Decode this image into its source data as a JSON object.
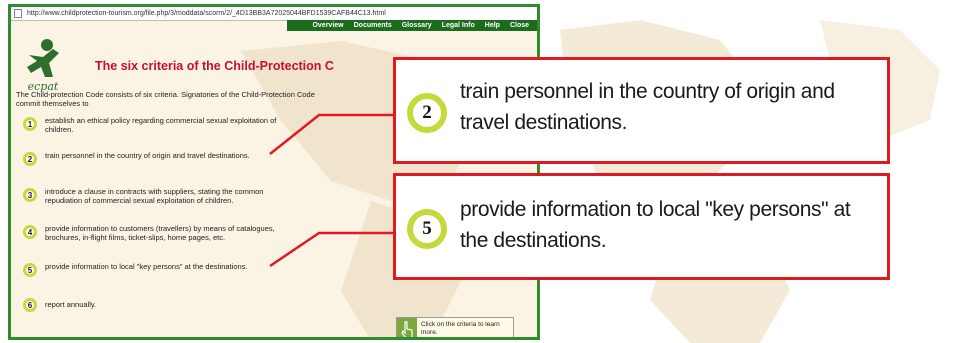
{
  "browser": {
    "url": "http://www.childprotection-tourism.org/file.php/3/moddata/scorm/2/_4D13BB3A72025044BFD1539CAFB44C13.html"
  },
  "nav": [
    "Overview",
    "Documents",
    "Glossary",
    "Legal Info",
    "Help",
    "Close"
  ],
  "logo": {
    "text": "ecpat"
  },
  "title": "The six criteria of the Child-Protection C",
  "intro": "The Child-protection Code consists of six criteria. Signatories of the Child-Protection Code commit themselves to",
  "criteria": [
    {
      "num": "1",
      "text": "establish an ethical policy regarding commercial sexual exploitation of children."
    },
    {
      "num": "2",
      "text": "train personnel in the country of origin and travel destinations."
    },
    {
      "num": "3",
      "text": "introduce a clause in contracts with suppliers, stating the common repudiation of commercial sexual exploitation of children."
    },
    {
      "num": "4",
      "text": "provide information to customers (travellers) by means of catalogues, brochures, in-flight films, ticket-slips, home pages, etc."
    },
    {
      "num": "5",
      "text": "provide information to local \"key persons\" at the destinations."
    },
    {
      "num": "6",
      "text": "report annually."
    }
  ],
  "hint": {
    "text": "Click on the criteria to learn more.",
    "icon": "hand-pointer-icon"
  },
  "callouts": [
    {
      "num": "2",
      "text": "train personnel in the country of origin and travel destinations."
    },
    {
      "num": "5",
      "text": "provide information to local \"key persons\" at the destinations."
    }
  ],
  "colors": {
    "frame_green": "#2e8b2e",
    "nav_green": "#1d6b1d",
    "title_red": "#c8102e",
    "callout_red": "#e01a22",
    "circle_lime": "#c6d93a"
  }
}
